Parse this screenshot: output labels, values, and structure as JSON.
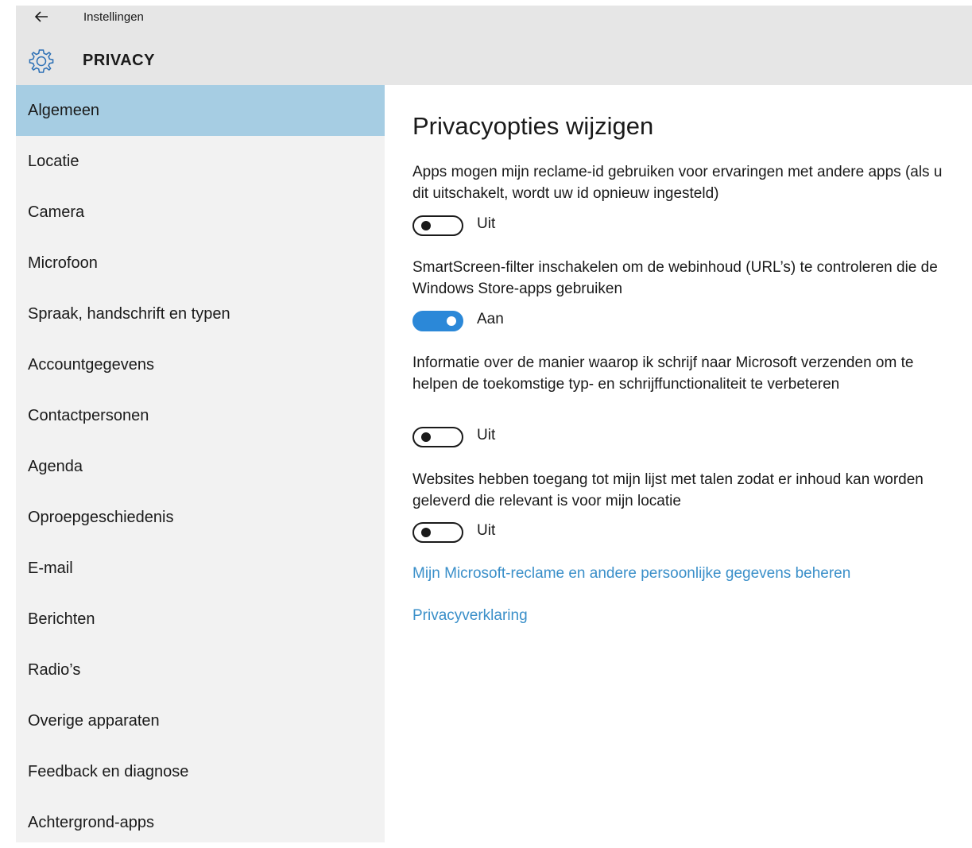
{
  "window": {
    "app_title": "Instellingen",
    "section_title": "PRIVACY",
    "back_icon": "back-arrow-icon",
    "section_icon": "gear-icon"
  },
  "sidebar": {
    "items": [
      {
        "label": "Algemeen",
        "selected": true
      },
      {
        "label": "Locatie",
        "selected": false
      },
      {
        "label": "Camera",
        "selected": false
      },
      {
        "label": "Microfoon",
        "selected": false
      },
      {
        "label": "Spraak, handschrift en typen",
        "selected": false
      },
      {
        "label": "Accountgegevens",
        "selected": false
      },
      {
        "label": "Contactpersonen",
        "selected": false
      },
      {
        "label": "Agenda",
        "selected": false
      },
      {
        "label": "Oproepgeschiedenis",
        "selected": false
      },
      {
        "label": "E-mail",
        "selected": false
      },
      {
        "label": "Berichten",
        "selected": false
      },
      {
        "label": "Radio’s",
        "selected": false
      },
      {
        "label": "Overige apparaten",
        "selected": false
      },
      {
        "label": "Feedback en diagnose",
        "selected": false
      },
      {
        "label": "Achtergrond-apps",
        "selected": false
      }
    ]
  },
  "main": {
    "title": "Privacyopties wijzigen",
    "options": [
      {
        "description": "Apps mogen mijn reclame-id gebruiken voor ervaringen met andere apps (als u dit uitschakelt, wordt uw id opnieuw ingesteld)",
        "on": false,
        "state_label": "Uit"
      },
      {
        "description": "SmartScreen-filter inschakelen om de webinhoud (URL’s) te controleren die de Windows Store-apps gebruiken",
        "on": true,
        "state_label": "Aan"
      },
      {
        "description": "Informatie over de manier waarop ik schrijf naar Microsoft verzenden om te helpen de toekomstige typ- en schrijffunctionaliteit te verbeteren",
        "on": false,
        "state_label": "Uit"
      },
      {
        "description": "Websites hebben toegang tot mijn lijst met talen zodat er inhoud kan worden geleverd die relevant is voor mijn locatie",
        "on": false,
        "state_label": "Uit"
      }
    ],
    "links": [
      {
        "label": "Mijn Microsoft-reclame en andere persoonlijke gegevens beheren"
      },
      {
        "label": "Privacyverklaring"
      }
    ]
  },
  "colors": {
    "selected_item": "#a6cde3",
    "toggle_on": "#2b88d8",
    "link": "#3a8fc9",
    "sidebar_bg": "#f2f2f2",
    "topbar_bg": "#e6e6e6"
  }
}
